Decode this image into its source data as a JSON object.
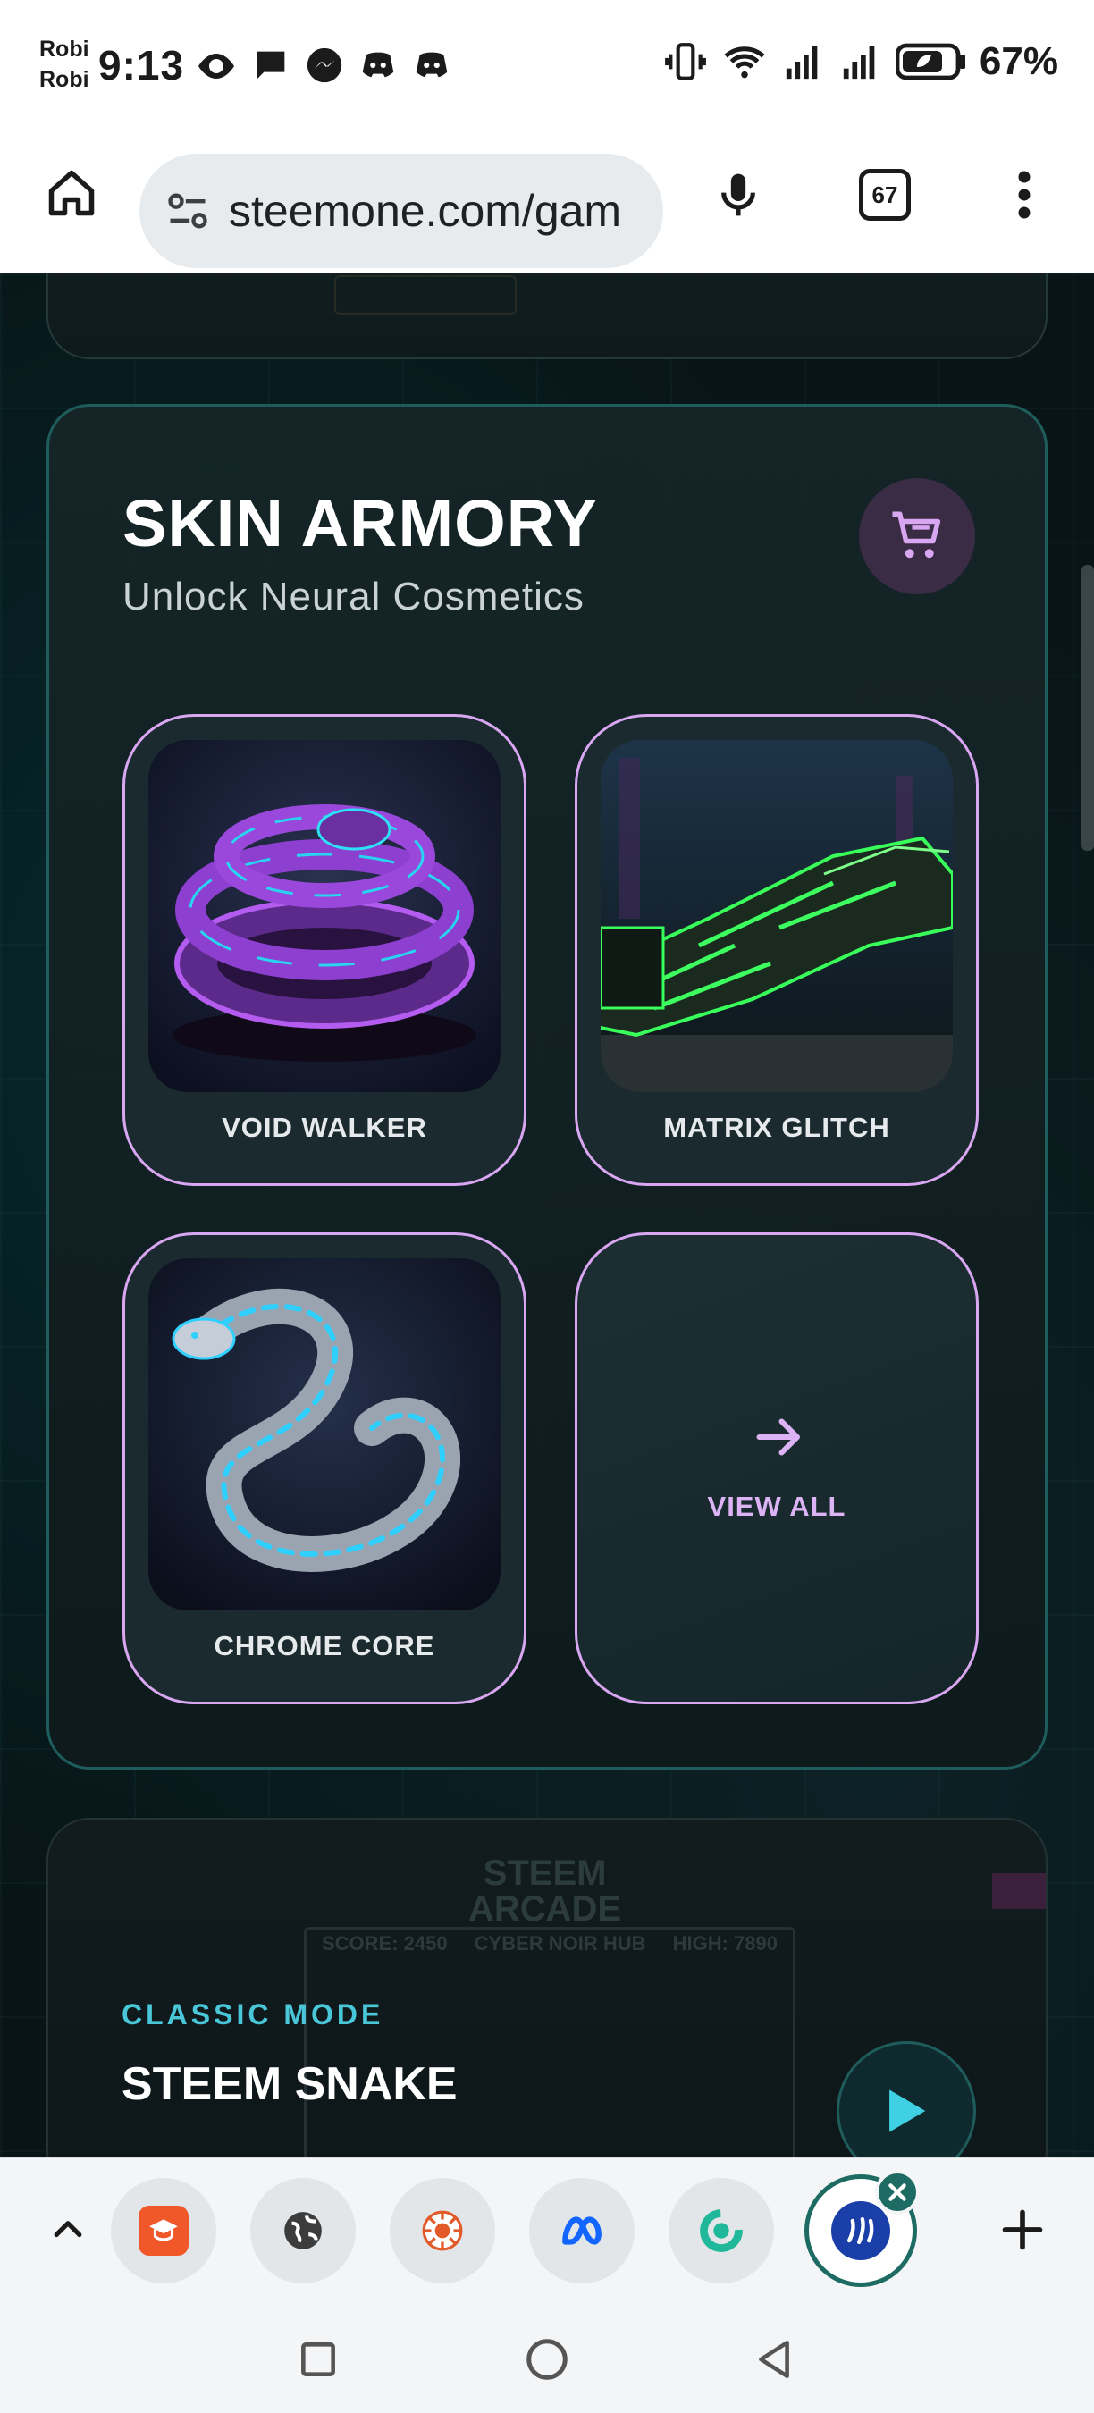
{
  "status_bar": {
    "carrier_line1": "Robi",
    "carrier_line2": "Robi",
    "time": "9:13",
    "battery_percent": "67%",
    "left_icons": [
      "eye-icon",
      "chat-bubble-icon",
      "messenger-icon",
      "discord-icon",
      "discord-icon"
    ],
    "right_icons": [
      "vibrate-icon",
      "wifi-icon",
      "signal-icon",
      "signal-icon",
      "battery-saver-icon"
    ]
  },
  "browser": {
    "url": "steemone.com/gam",
    "tab_count": "67",
    "icons": [
      "home-icon",
      "tune-icon",
      "mic-icon",
      "tabs-icon",
      "more-vert-icon"
    ]
  },
  "armory": {
    "title": "SKIN ARMORY",
    "subtitle": "Unlock Neural Cosmetics",
    "cart_icon": "cart-icon",
    "skins": [
      {
        "label": "VOID WALKER",
        "image": "purple-coiled-cyber-serpent"
      },
      {
        "label": "MATRIX GLITCH",
        "image": "green-circuit-cyber-arm"
      },
      {
        "label": "CHROME CORE",
        "image": "chrome-cyan-cyber-snake"
      }
    ],
    "view_all_label": "VIEW ALL"
  },
  "game_card": {
    "mode": "CLASSIC MODE",
    "title": "STEEM SNAKE",
    "bg_logo_line1": "STEEM",
    "bg_logo_line2": "ARCADE",
    "bg_hud_left": "SCORE: 2450",
    "bg_hud_center": "CYBER NOIR HUB",
    "bg_hud_right": "HIGH: 7890"
  },
  "tab_strip": {
    "tabs": [
      "course-app-tab",
      "globe-tab",
      "radar-tab",
      "meta-tab",
      "chatgpt-tab",
      "steem-tab"
    ],
    "active_tab": "steem-tab"
  },
  "colors": {
    "accent_purple": "#d9a6f2",
    "accent_teal": "#49c6d8",
    "card_border": "#1f5c5c",
    "steem_green": "#1d6b62"
  }
}
